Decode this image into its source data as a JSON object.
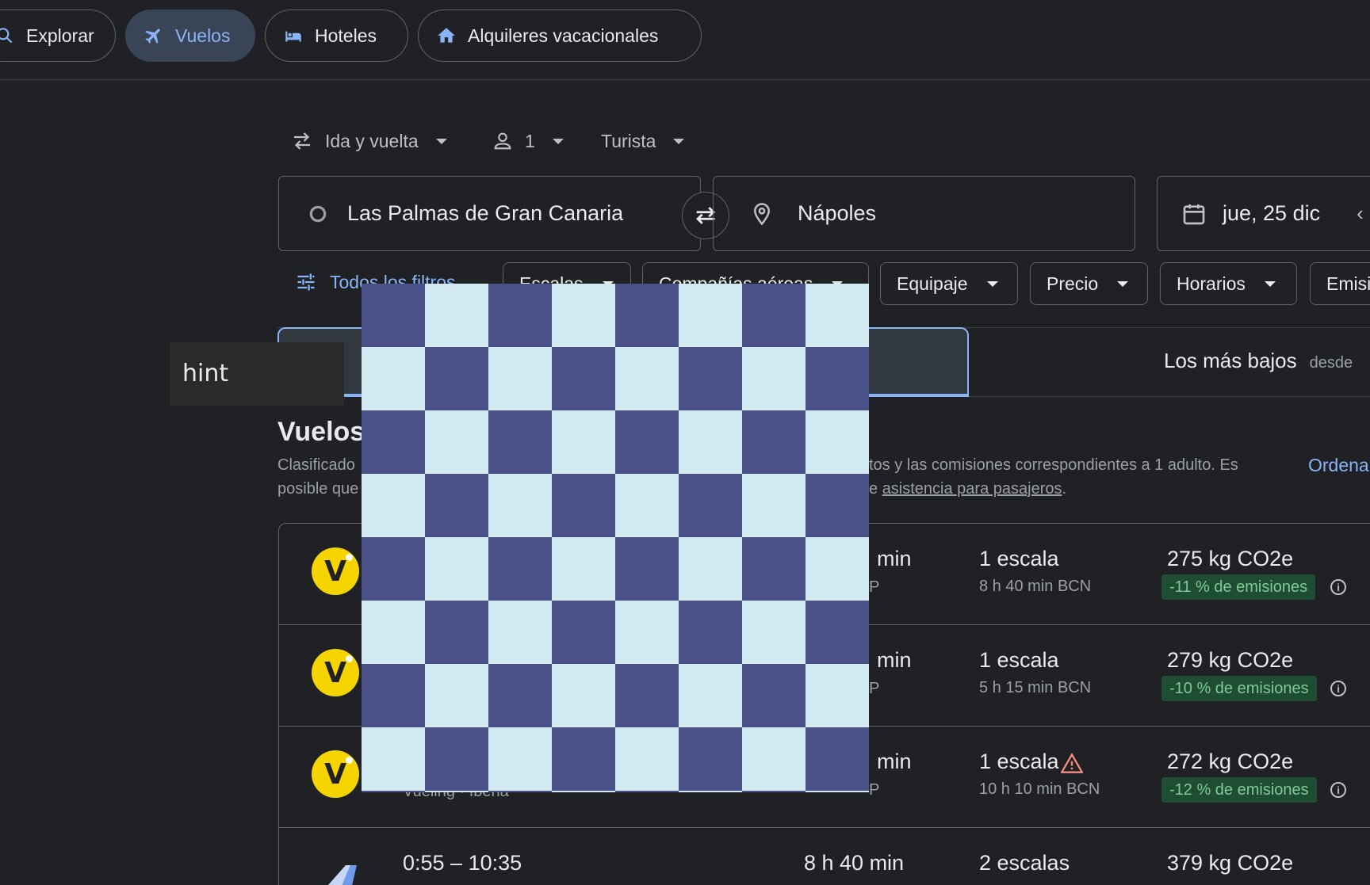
{
  "nav": {
    "explore": "Explorar",
    "flights": "Vuelos",
    "hotels": "Hoteles",
    "vacation_rentals": "Alquileres vacacionales"
  },
  "trip": {
    "type": "Ida y vuelta",
    "passengers": "1",
    "cabin": "Turista"
  },
  "search": {
    "origin": "Las Palmas de Gran Canaria",
    "destination": "Nápoles",
    "departure_date": "jue, 25 dic"
  },
  "filters": {
    "all": "Todos los filtros",
    "stops": "Escalas",
    "airlines": "Compañías aéreas",
    "bags": "Equipaje",
    "price": "Precio",
    "times": "Horarios",
    "emissions": "Emisi"
  },
  "tabs": {
    "cheapest": "Los más bajos",
    "cheapest_from": "desde"
  },
  "results": {
    "title": "Vuelos",
    "desc_line1_start": "Clasificado",
    "desc_line1_end": "tos y las comisiones correspondientes a 1 adulto. Es",
    "desc_line2_start": "posible que",
    "desc_line2_mid": "e ",
    "desc_link": "asistencia para pasajeros",
    "desc_line2_end": ".",
    "sort": "Ordena"
  },
  "flights": [
    {
      "logo": "V",
      "duration": "min",
      "airports": "P",
      "stops": "1 escala",
      "stop_detail": "8 h 40 min BCN",
      "co2": "275 kg CO2e",
      "emissions": "-11 % de emisiones",
      "warning": false
    },
    {
      "logo": "V",
      "duration": "min",
      "airports": "P",
      "stops": "1 escala",
      "stop_detail": "5 h 15 min BCN",
      "co2": "279 kg CO2e",
      "emissions": "-10 % de emisiones",
      "warning": false
    },
    {
      "logo": "V",
      "duration": "min",
      "airports": "P",
      "stops": "1 escala",
      "stop_detail": "10 h 10 min BCN",
      "co2": "272 kg CO2e",
      "emissions": "-12 % de emisiones",
      "warning": true,
      "airline_partial": "Vueling · Iberia"
    },
    {
      "logo": "",
      "times": "0:55 – 10:35",
      "duration": "8 h 40 min",
      "stops": "2 escalas",
      "co2": "379 kg CO2e"
    }
  ],
  "overlay": {
    "hint": "hint"
  }
}
